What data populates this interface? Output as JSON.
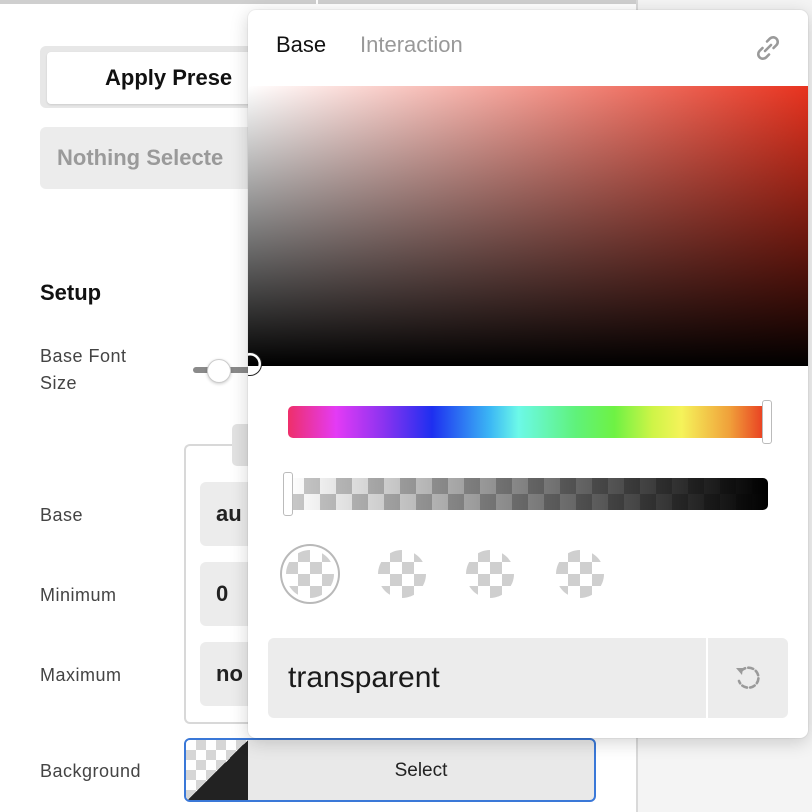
{
  "background_panel": {
    "apply_preset_label": "Apply Prese",
    "nothing_selected_label": "Nothing Selecte",
    "setup_heading": "Setup",
    "base_font_size_label_line1": "Base Font",
    "base_font_size_label_line2": "Size",
    "base_label": "Base",
    "base_value": "au",
    "minimum_label": "Minimum",
    "minimum_value": "0",
    "maximum_label": "Maximum",
    "maximum_value": "no",
    "background_label": "Background",
    "background_select_label": "Select"
  },
  "color_picker": {
    "tabs": [
      {
        "label": "Base",
        "active": true
      },
      {
        "label": "Interaction",
        "active": false
      }
    ],
    "hue_color": "#e8331f",
    "hue_fraction": 0.99,
    "alpha_fraction": 0.0,
    "value": "transparent"
  },
  "icons": {
    "link": "link-icon",
    "reset": "reset-icon"
  }
}
